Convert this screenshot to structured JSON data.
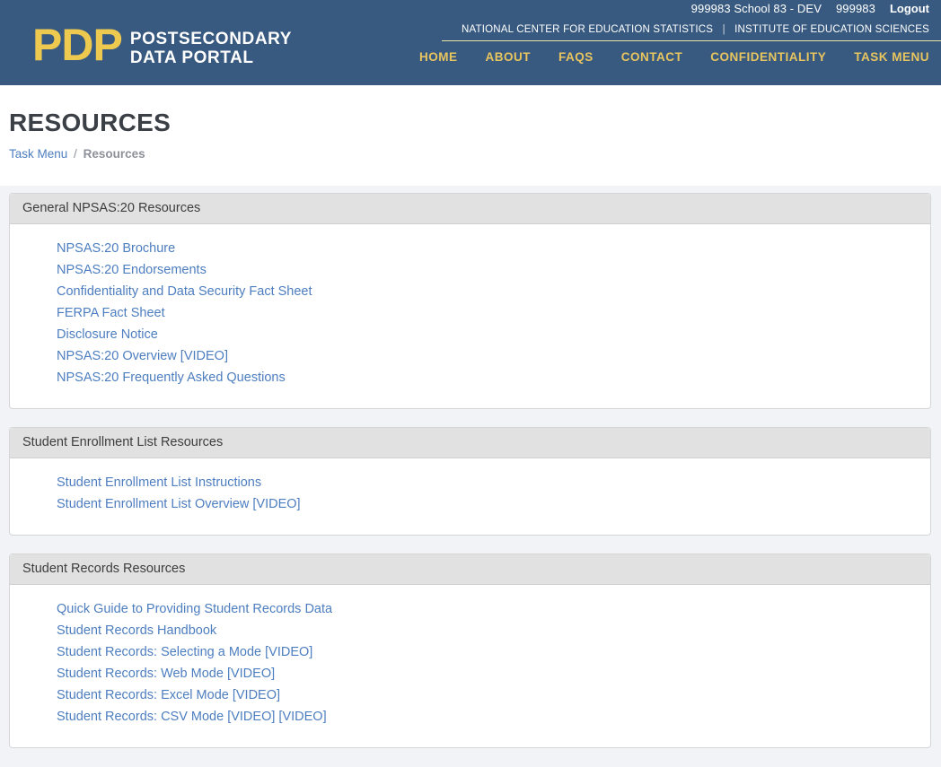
{
  "topbar": {
    "school": "999983 School 83 - DEV",
    "school_id": "999983",
    "logout": "Logout"
  },
  "header": {
    "logo_acronym": "PDP",
    "logo_line1": "POSTSECONDARY",
    "logo_line2": "DATA PORTAL",
    "org_left": "NATIONAL CENTER FOR EDUCATION STATISTICS",
    "org_divider": "|",
    "org_right": "INSTITUTE OF EDUCATION SCIENCES",
    "nav": [
      "HOME",
      "ABOUT",
      "FAQS",
      "CONTACT",
      "CONFIDENTIALITY",
      "TASK MENU"
    ]
  },
  "page": {
    "title": "RESOURCES",
    "breadcrumb": {
      "link": "Task Menu",
      "separator": "/",
      "current": "Resources"
    }
  },
  "sections": [
    {
      "title": "General NPSAS:20 Resources",
      "links": [
        "NPSAS:20 Brochure",
        "NPSAS:20 Endorsements",
        "Confidentiality and Data Security Fact Sheet",
        "FERPA Fact Sheet",
        "Disclosure Notice",
        "NPSAS:20 Overview [VIDEO]",
        "NPSAS:20 Frequently Asked Questions"
      ]
    },
    {
      "title": "Student Enrollment List Resources",
      "links": [
        "Student Enrollment List Instructions",
        "Student Enrollment List Overview [VIDEO]"
      ]
    },
    {
      "title": "Student Records Resources",
      "links": [
        "Quick Guide to Providing Student Records Data",
        "Student Records Handbook",
        "Student Records: Selecting a Mode [VIDEO]",
        "Student Records: Web Mode [VIDEO]",
        "Student Records: Excel Mode [VIDEO]",
        "Student Records: CSV Mode [VIDEO] [VIDEO]"
      ]
    }
  ],
  "colors": {
    "header_blue": "#385a80",
    "brand_yellow": "#eec94f",
    "nav_yellow": "#e8c55f",
    "link_blue": "#4d7ec0",
    "panel_header_bg": "#e1e1e1",
    "section_bg": "#f2f3f7",
    "divider_line": "#e9e5a4"
  }
}
